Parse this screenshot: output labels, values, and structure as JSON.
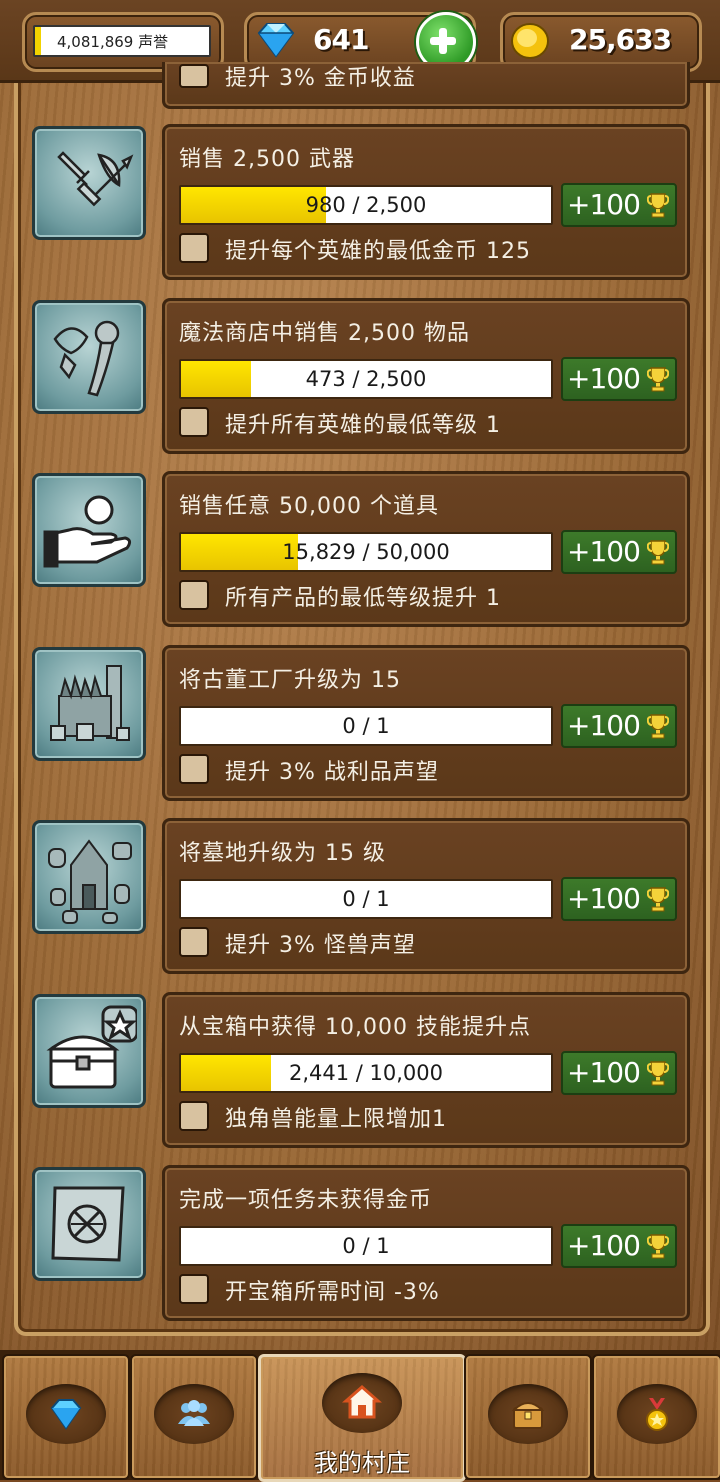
{
  "header": {
    "reputation_label": "4,081,869 声誉",
    "gems": "641",
    "gold": "25,633"
  },
  "partial_perk": "提升 3% 金币收益",
  "quests": [
    {
      "title": "销售 2,500 武器",
      "progress": "980 / 2,500",
      "progress_fraction": 0.392,
      "reward": "+100",
      "perk": "提升每个英雄的最低金币 125",
      "icon": "weapons-icon"
    },
    {
      "title": "魔法商店中销售 2,500 物品",
      "progress": "473 / 2,500",
      "progress_fraction": 0.189,
      "reward": "+100",
      "perk": "提升所有英雄的最低等级 1",
      "icon": "magic-items-icon"
    },
    {
      "title": "销售任意 50,000 个道具",
      "progress": "15,829 / 50,000",
      "progress_fraction": 0.317,
      "reward": "+100",
      "perk": "所有产品的最低等级提升 1",
      "icon": "hand-sell-icon"
    },
    {
      "title": "将古董工厂升级为 15",
      "progress": "0 / 1",
      "progress_fraction": 0,
      "reward": "+100",
      "perk": "提升 3% 战利品声望",
      "icon": "factory-icon"
    },
    {
      "title": "将墓地升级为 15 级",
      "progress": "0 / 1",
      "progress_fraction": 0,
      "reward": "+100",
      "perk": "提升 3% 怪兽声望",
      "icon": "graveyard-icon"
    },
    {
      "title": "从宝箱中获得 10,000 技能提升点",
      "progress": "2,441 / 10,000",
      "progress_fraction": 0.244,
      "reward": "+100",
      "perk": "独角兽能量上限增加1",
      "icon": "chest-star-icon"
    },
    {
      "title": "完成一项任务未获得金币",
      "progress": "0 / 1",
      "progress_fraction": 0,
      "reward": "+100",
      "perk": "开宝箱所需时间 -3%",
      "icon": "quest-scroll-icon"
    }
  ],
  "nav": {
    "village_label": "我的村庄"
  }
}
